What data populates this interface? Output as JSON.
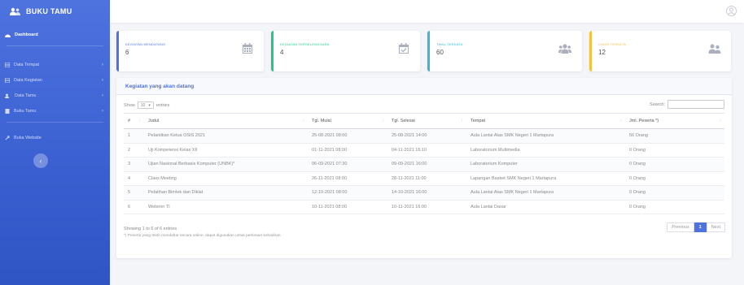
{
  "brand": {
    "title": "BUKU TAMU",
    "icon": "users-icon"
  },
  "sidebar": {
    "items": [
      {
        "label": "Dashboard",
        "icon": "tachometer-icon",
        "active": true
      },
      {
        "label": "Data Tempat",
        "icon": "table-icon"
      },
      {
        "label": "Data Kegiatan",
        "icon": "table-icon"
      },
      {
        "label": "Data Tamu",
        "icon": "users-icon"
      },
      {
        "label": "Buku Tamu",
        "icon": "book-icon"
      }
    ],
    "website_link": "Buka Website",
    "toggle": "‹"
  },
  "cards": [
    {
      "title": "KEGIATAN MENDATANG",
      "value": "6",
      "color": "#4e73df",
      "icon": "calendar-icon"
    },
    {
      "title": "KEGIATAN TERSELENGGARA",
      "value": "4",
      "color": "#1cc88a",
      "icon": "calendar-check-icon"
    },
    {
      "title": "TAMU TERDATA",
      "value": "60",
      "color": "#36b9cc",
      "icon": "users-icon"
    },
    {
      "title": "HADIR TERDATA",
      "value": "12",
      "color": "#f6c23e",
      "icon": "user-group-icon"
    }
  ],
  "panel": {
    "title": "Kegiatan yang akan datang",
    "show_label": "Show",
    "entries_value": "10",
    "entries_label": "entries",
    "search_label": "Search:",
    "columns": [
      "#",
      "Judul",
      "Tgl. Mulai",
      "Tgl. Selesai",
      "Tempat",
      "Jml. Peserta *)"
    ],
    "rows": [
      [
        "1",
        "Pelantikan Ketua OSIS 2021",
        "25-08-2021 08:00",
        "25-08-2021 14:00",
        "Aula Lantai Atas SMK Negeri 1 Martapura",
        "56 Orang"
      ],
      [
        "2",
        "Uji Kompetensi Kelas XII",
        "01-11-2021 08:00",
        "04-11-2021 16:10",
        "Laboratorium Multimedia",
        "0 Orang"
      ],
      [
        "3",
        "Ujian Nasional Berbasis Komputer (UNBK)*",
        "06-09-2021 07:30",
        "09-09-2021 16:00",
        "Laboratorium Komputer",
        "0 Orang"
      ],
      [
        "4",
        "Class Meeting",
        "26-11-2021 08:00",
        "28-11-2021 11:00",
        "Lapangan Basket SMK Negeri 1 Martapura",
        "0 Orang"
      ],
      [
        "5",
        "Pelatihan Bimtek dan Diklat",
        "12-10-2021 08:00",
        "14-10-2021 16:00",
        "Aula Lantai Atas SMK Negeri 1 Martapura",
        "0 Orang"
      ],
      [
        "6",
        "Webiner TI",
        "10-11-2021 08:00",
        "10-11-2021 16:00",
        "Aula Lantai Dasar",
        "0 Orang"
      ]
    ],
    "info": "Showing 1 to 6 of 6 entries",
    "note": "*) Peserta yang telah mendaftar secara online, dapat digunakan untuk perkiraan kehadiran",
    "pager": {
      "previous": "Previous",
      "current": "1",
      "next": "Next"
    }
  }
}
